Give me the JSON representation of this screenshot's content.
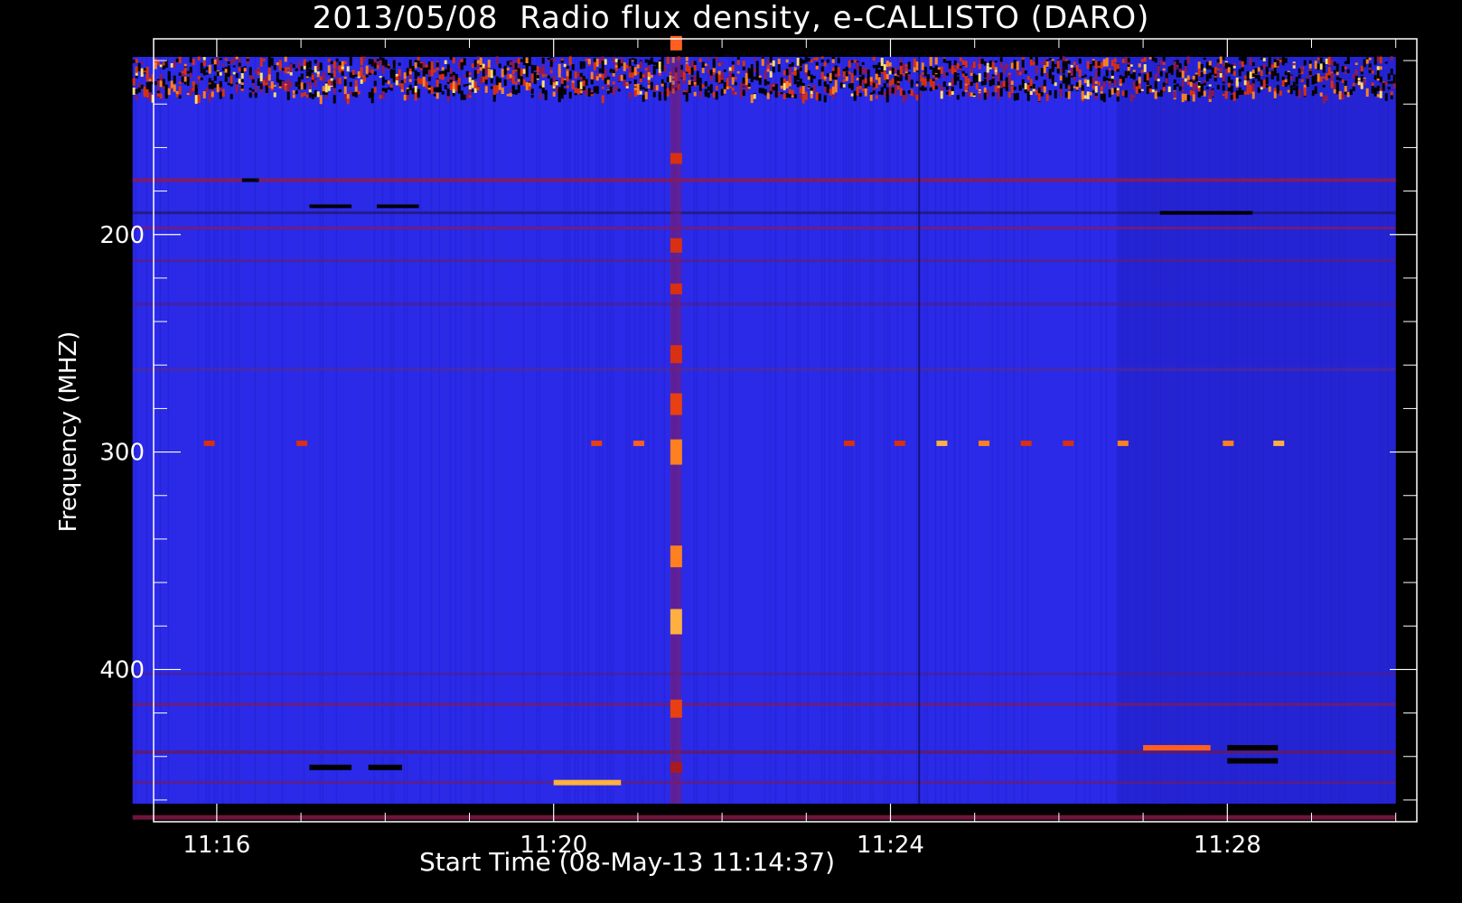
{
  "chart_data": {
    "type": "heatmap",
    "title": "2013/05/08  Radio flux density, e-CALLISTO (DARO)",
    "xlabel": "Start Time (08-May-13 11:14:37)",
    "ylabel": "Frequency (MHZ)",
    "x_tick_labels": [
      "11:16",
      "11:20",
      "11:24",
      "11:28"
    ],
    "x_ticks_minutes": [
      16,
      20,
      24,
      28
    ],
    "xlim_minutes": [
      15.25,
      30.25
    ],
    "y_tick_labels": [
      "200",
      "300",
      "400"
    ],
    "y_ticks": [
      200,
      300,
      400
    ],
    "ylim": [
      110,
      470
    ],
    "y_reversed": true,
    "data_time_range_minutes": [
      15.0,
      30.0
    ],
    "data_freq_range": [
      110,
      470
    ],
    "colormap": [
      "#000000",
      "#1616a0",
      "#2a2ae8",
      "#8a1a5a",
      "#d83010",
      "#ff8020",
      "#ffe070",
      "#ffffff"
    ],
    "background_color": "#2a2ae8",
    "features": [
      {
        "name": "type III burst",
        "time_minutes": 21.4,
        "freq_range": [
          110,
          470
        ]
      },
      {
        "name": "interference band",
        "freq_range": [
          118,
          136
        ]
      },
      {
        "name": "narrowband emission",
        "freq": 296
      }
    ]
  }
}
